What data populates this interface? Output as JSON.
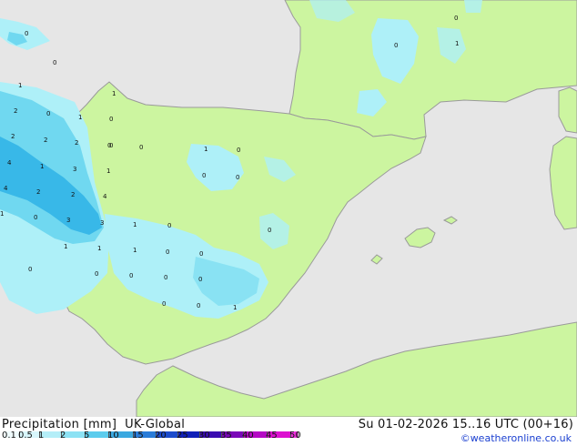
{
  "map": {
    "colors": {
      "sea": "#e6e6e6",
      "land": "#ccf5a0",
      "border": "#9a9a9a",
      "precip_light": "#aef0f8",
      "precip_mid": "#70d8f0",
      "precip_heavy": "#38b8e8"
    },
    "labels": [
      "0",
      "0",
      "1",
      "1",
      "2",
      "0",
      "1",
      "0",
      "2",
      "2",
      "2",
      "0",
      "4",
      "1",
      "3",
      "1",
      "4",
      "2",
      "2",
      "4",
      "1",
      "0",
      "3",
      "3",
      "1",
      "1",
      "1",
      "1",
      "0",
      "0",
      "0",
      "1",
      "0",
      "0",
      "0",
      "0",
      "0",
      "0",
      "0",
      "0",
      "0",
      "0",
      "0",
      "0",
      "1",
      "0",
      "0",
      "1",
      "0"
    ]
  },
  "footer": {
    "title": "Precipitation [mm]  UK-Global",
    "datetime": "Su 01-02-2026 15..16 UTC (00+16)",
    "credit": "©weatheronline.co.uk"
  },
  "legend": {
    "ticks": [
      "0.1",
      "0.5",
      "1",
      "2",
      "5",
      "10",
      "15",
      "20",
      "25",
      "30",
      "35",
      "40",
      "45",
      "50"
    ],
    "colors": [
      "#f0fcfe",
      "#d8f6fc",
      "#b4eef8",
      "#8ce2f4",
      "#5ccced",
      "#3aa8e0",
      "#2a7cd8",
      "#1c4ccc",
      "#1020b8",
      "#3a0cb0",
      "#7a08b8",
      "#b408c4",
      "#dc10d0",
      "#f030e0"
    ]
  }
}
